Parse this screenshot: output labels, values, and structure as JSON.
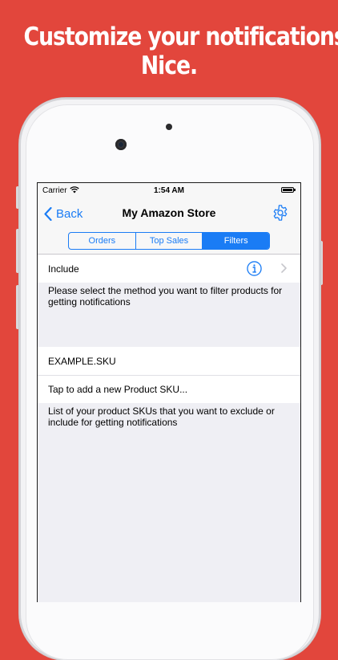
{
  "headline": {
    "line1": "Customize your notifications.",
    "line2": "Nice."
  },
  "status_bar": {
    "carrier": "Carrier",
    "time": "1:54 AM"
  },
  "nav": {
    "back_label": "Back",
    "title": "My Amazon Store"
  },
  "tabs": [
    {
      "label": "Orders",
      "active": false
    },
    {
      "label": "Top Sales",
      "active": false
    },
    {
      "label": "Filters",
      "active": true
    }
  ],
  "filter": {
    "method_label": "Include",
    "method_footer": "Please select the method you want to filter products for getting notifications"
  },
  "skus": {
    "items": [
      "EXAMPLE.SKU"
    ],
    "add_placeholder": "Tap to add a new Product SKU...",
    "footer": "List of your product SKUs that you want to exclude or include for getting notifications"
  },
  "colors": {
    "background": "#e2463c",
    "accent": "#1a7cf5"
  }
}
